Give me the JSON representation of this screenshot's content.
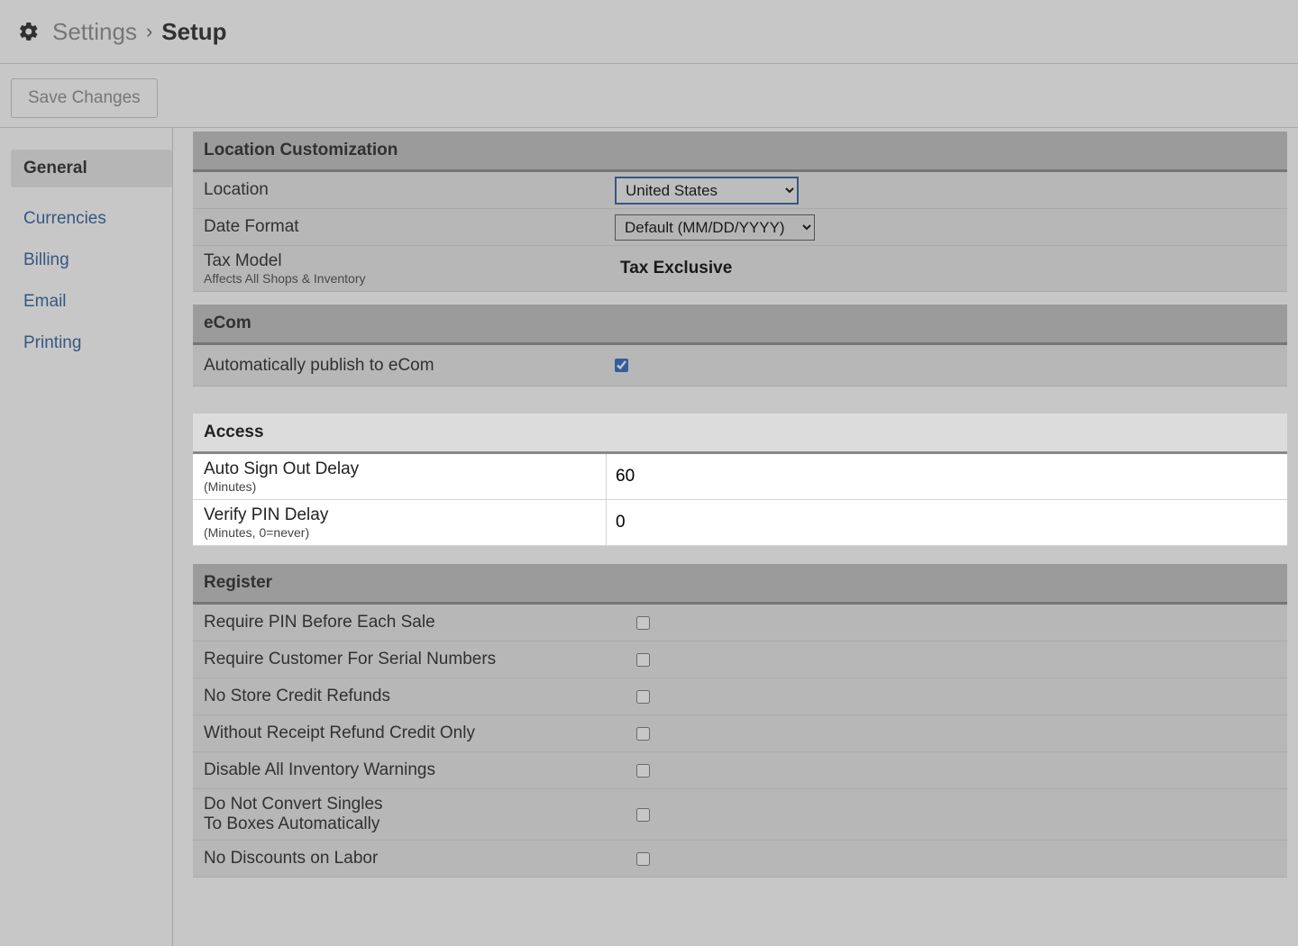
{
  "header": {
    "breadcrumb_root": "Settings",
    "breadcrumb_leaf": "Setup"
  },
  "toolbar": {
    "save_label": "Save Changes"
  },
  "sidebar": {
    "items": [
      {
        "label": "General",
        "active": true
      },
      {
        "label": "Currencies"
      },
      {
        "label": "Billing"
      },
      {
        "label": "Email"
      },
      {
        "label": "Printing"
      }
    ]
  },
  "sections": {
    "location_customization": {
      "title": "Location Customization",
      "location_label": "Location",
      "location_value": "United States",
      "date_format_label": "Date Format",
      "date_format_value": "Default (MM/DD/YYYY)",
      "tax_model_label": "Tax Model",
      "tax_model_sub": "Affects All Shops & Inventory",
      "tax_model_value": "Tax Exclusive"
    },
    "ecom": {
      "title": "eCom",
      "auto_publish_label": "Automatically publish to eCom",
      "auto_publish_checked": true
    },
    "access": {
      "title": "Access",
      "auto_signout_label": "Auto Sign Out Delay",
      "auto_signout_sub": "(Minutes)",
      "auto_signout_value": "60",
      "verify_pin_label": "Verify PIN Delay",
      "verify_pin_sub": "(Minutes, 0=never)",
      "verify_pin_value": "0"
    },
    "register": {
      "title": "Register",
      "rows": [
        "Require PIN Before Each Sale",
        "Require Customer For Serial Numbers",
        "No Store Credit Refunds",
        "Without Receipt Refund Credit Only",
        "Disable All Inventory Warnings",
        "Do Not Convert Singles\nTo Boxes Automatically",
        "No Discounts on Labor"
      ]
    }
  }
}
